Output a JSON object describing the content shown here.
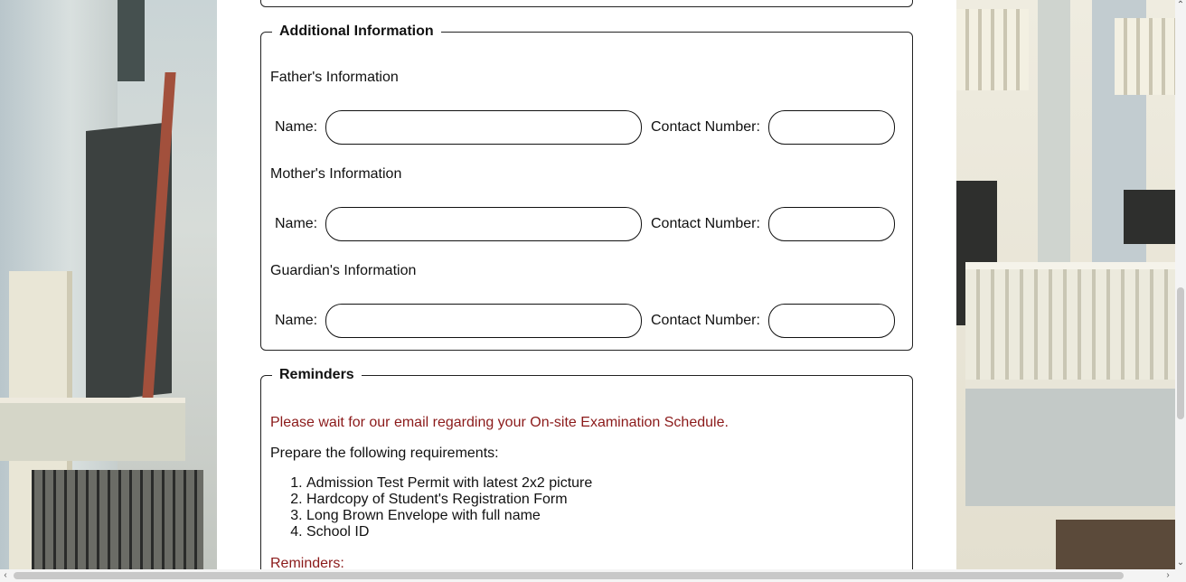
{
  "sections": {
    "additional": {
      "legend": "Additional Information",
      "groups": [
        {
          "heading": "Father's Information",
          "name_label": "Name:",
          "name_value": "",
          "contact_label": "Contact Number:",
          "contact_value": ""
        },
        {
          "heading": "Mother's Information",
          "name_label": "Name:",
          "name_value": "",
          "contact_label": "Contact Number:",
          "contact_value": ""
        },
        {
          "heading": "Guardian's Information",
          "name_label": "Name:",
          "name_value": "",
          "contact_label": "Contact Number:",
          "contact_value": ""
        }
      ]
    },
    "reminders": {
      "legend": "Reminders",
      "notice": "Please wait for our email regarding your On-site Examination Schedule.",
      "prepare": "Prepare the following requirements:",
      "requirements": [
        "Admission Test Permit with latest 2x2 picture",
        "Hardcopy of Student's Registration Form",
        "Long Brown Envelope with full name",
        "School ID"
      ],
      "reminders_label": "Reminders:"
    }
  },
  "colors": {
    "accent_red": "#8b1a1a",
    "border": "#222222",
    "panel_bg": "#ffffff"
  },
  "scrollbars": {
    "up_icon": "chevron-up-icon",
    "down_icon": "chevron-down-icon",
    "left_icon": "chevron-left-icon",
    "right_icon": "chevron-right-icon"
  }
}
